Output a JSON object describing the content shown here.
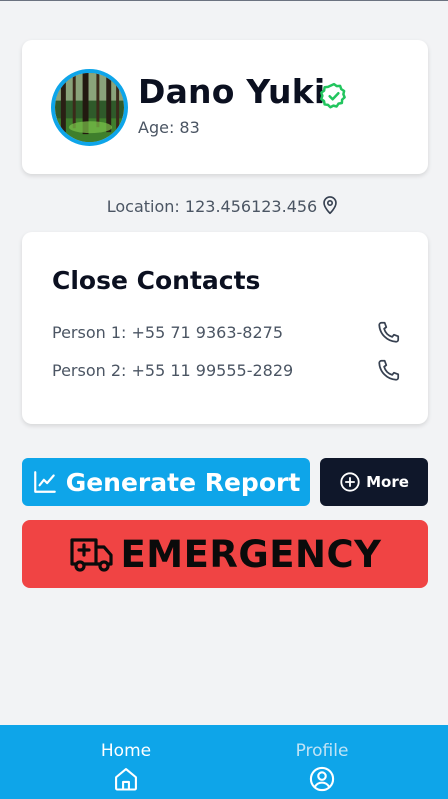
{
  "profile": {
    "name": "Dano Yuki",
    "age": "Age: 83"
  },
  "location": {
    "text": "Location: 123.456123.456"
  },
  "contacts": {
    "title": "Close Contacts",
    "items": [
      {
        "text": "Person 1: +55 71 9363-8275"
      },
      {
        "text": "Person 2: +55 11 99555-2829"
      }
    ]
  },
  "actions": {
    "report_label": "Generate Report",
    "more_label": "More",
    "emergency_label": "EMERGENCY"
  },
  "nav": {
    "home_label": "Home",
    "profile_label": "Profile"
  },
  "colors": {
    "accent": "#0ea5e9",
    "emergency": "#f04444",
    "dark_button": "#0f172a",
    "verified": "#22c55e",
    "background": "#f2f3f5"
  },
  "icons": {
    "verified": "check-badge-icon",
    "location": "map-pin-icon",
    "phone": "phone-icon",
    "report": "line-chart-icon",
    "more": "plus-circle-icon",
    "emergency": "ambulance-icon",
    "home": "home-icon",
    "profile": "user-circle-icon"
  }
}
